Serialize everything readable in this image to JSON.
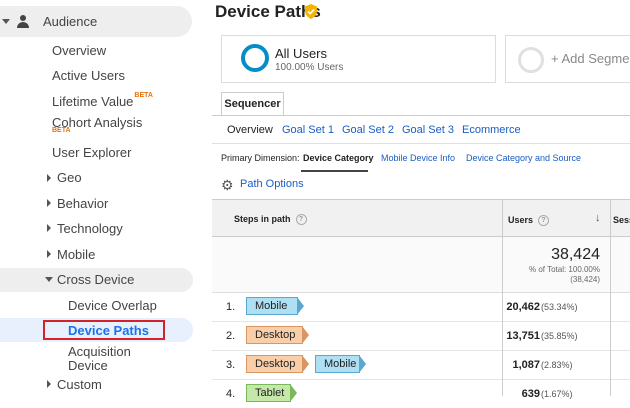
{
  "sidebar": {
    "audience_label": "Audience",
    "items": [
      {
        "label": "Overview"
      },
      {
        "label": "Active Users"
      },
      {
        "label": "Lifetime Value",
        "badge": "BETA"
      },
      {
        "label": "Cohort Analysis",
        "badge": "BETA"
      },
      {
        "label": "User Explorer"
      },
      {
        "label": "Geo"
      },
      {
        "label": "Behavior"
      },
      {
        "label": "Technology"
      },
      {
        "label": "Mobile"
      },
      {
        "label": "Cross Device"
      },
      {
        "label": "Custom"
      }
    ],
    "cross_device_items": [
      {
        "label": "Device Overlap"
      },
      {
        "label": "Device Paths"
      },
      {
        "label": "Acquisition",
        "label2": "Device"
      }
    ]
  },
  "page": {
    "title": "Device Paths"
  },
  "segment": {
    "name": "All Users",
    "percent": "100.00% Users",
    "add_label": "+ Add Segment"
  },
  "sequencer_tab": "Sequencer",
  "tabs": [
    "Overview",
    "Goal Set 1",
    "Goal Set 2",
    "Goal Set 3",
    "Ecommerce"
  ],
  "primary_dimension": {
    "label": "Primary Dimension:",
    "options": [
      "Device Category",
      "Mobile Device Info",
      "Device Category and Source"
    ]
  },
  "path_options": "Path Options",
  "table": {
    "headers": {
      "steps": "Steps in path",
      "users": "Users",
      "sessions": "Sess"
    },
    "total": {
      "value": "38,424",
      "pct": "% of Total: 100.00%",
      "abs": "(38,424)"
    },
    "rows": [
      {
        "idx": "1.",
        "steps": [
          "Mobile"
        ],
        "users": "20,462",
        "pct": "(53.34%)"
      },
      {
        "idx": "2.",
        "steps": [
          "Desktop"
        ],
        "users": "13,751",
        "pct": "(35.85%)"
      },
      {
        "idx": "3.",
        "steps": [
          "Desktop",
          "Mobile"
        ],
        "users": "1,087",
        "pct": "(2.83%)"
      },
      {
        "idx": "4.",
        "steps": [
          "Tablet"
        ],
        "users": "639",
        "pct": "(1.67%)"
      }
    ]
  },
  "colors": {
    "accent": "#1a73e8",
    "link": "#1a5dc4",
    "ring": "#058dc7",
    "highlight_border": "#d0232b"
  }
}
